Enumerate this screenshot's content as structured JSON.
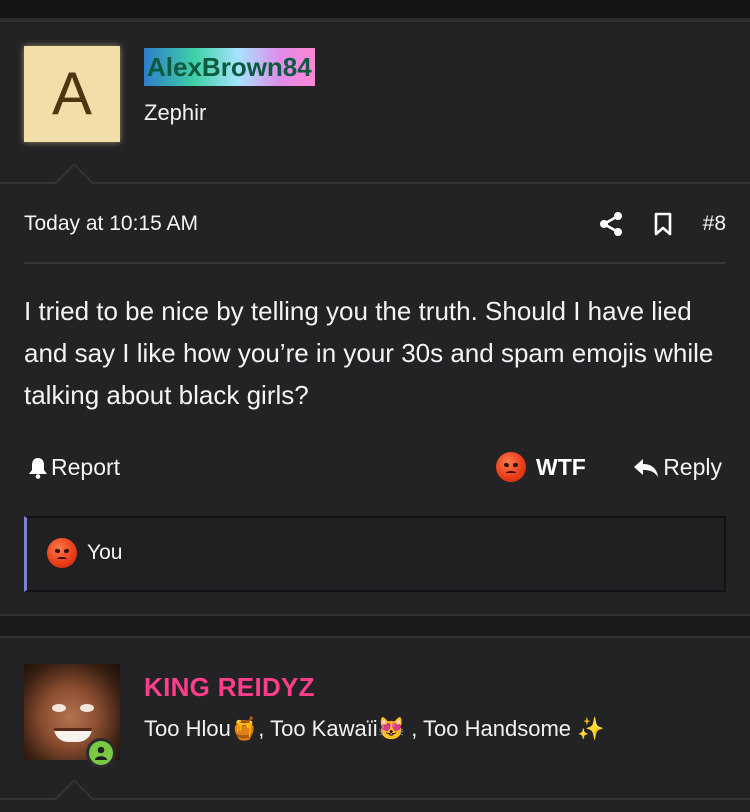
{
  "post1": {
    "avatar_letter": "A",
    "username": "AlexBrown84",
    "user_title": "Zephir",
    "timestamp": "Today at 10:15 AM",
    "post_number": "#8",
    "message": "I tried to be nice by telling you the truth. Should I have lied and say I like how you’re in your 30s and spam emojis while talking about black girls?",
    "report_label": "Report",
    "reaction_label": "WTF",
    "reply_label": "Reply",
    "reacted_by": "You"
  },
  "post2": {
    "username": "KING REIDYZ",
    "sig": {
      "part1": "Too Hlou",
      "emoji1": "🍯",
      "part2": ", Too Kawaïi",
      "emoji2": "😻",
      "part3": " , Too Handsome ",
      "emoji3": "✨"
    }
  },
  "colors": {
    "background": "#1b1b1d",
    "post_bg": "#232325",
    "username2": "#ff3f8c",
    "reaction_bar_accent": "#7a82d8",
    "online": "#7ac943"
  },
  "icons": {
    "share": "share-icon",
    "bookmark": "bookmark-icon",
    "report": "bell-icon",
    "reply": "reply-icon",
    "reaction": "angry-face-icon"
  }
}
